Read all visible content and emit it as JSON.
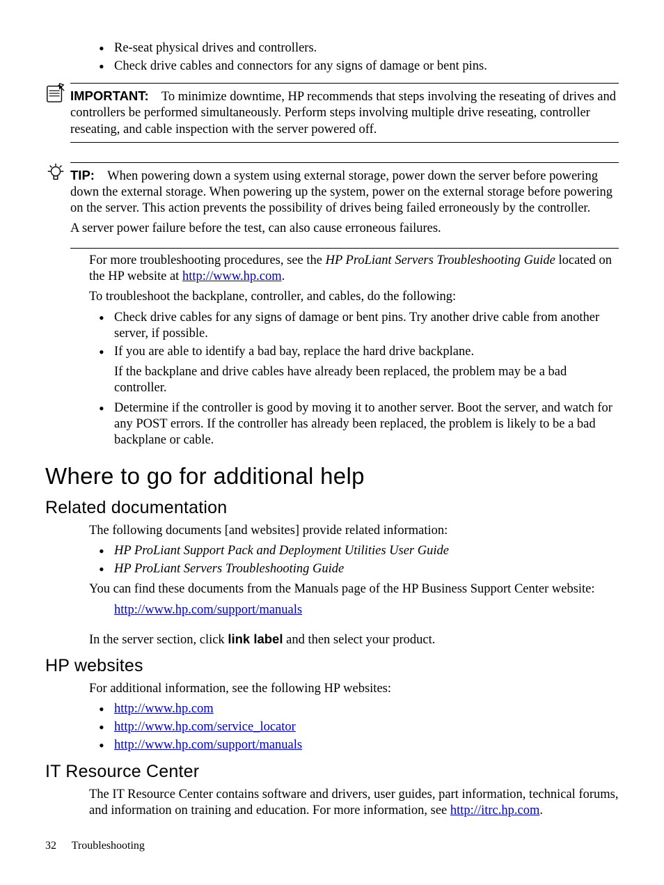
{
  "top_bullets": [
    "Re-seat physical drives and controllers.",
    "Check drive cables and connectors for any signs of damage or bent pins."
  ],
  "important": {
    "label": "IMPORTANT:",
    "text": "To minimize downtime, HP recommends that steps involving the reseating of drives and controllers be performed simultaneously. Perform steps involving multiple drive reseating, controller reseating, and cable inspection with the server powered off."
  },
  "tip": {
    "label": "TIP:",
    "p1": "When powering down a system using external storage, power down the server before powering down the external storage. When powering up the system, power on the external storage before powering on the server. This action prevents the possibility of drives being failed erroneously by the controller.",
    "p2": "A server power failure before the test, can also cause erroneous failures."
  },
  "after_tip": {
    "p1_pre": "For more troubleshooting procedures, see the ",
    "p1_em": "HP ProLiant Servers Troubleshooting Guide",
    "p1_mid": " located on the HP website at ",
    "p1_link": "http://www.hp.com",
    "p1_post": ".",
    "p2": "To troubleshoot the backplane, controller, and cables, do the following:"
  },
  "troubleshoot_bullets": {
    "b1": "Check drive cables for any signs of damage or bent pins. Try another drive cable from another server, if possible.",
    "b2": "If you are able to identify a bad bay, replace the hard drive backplane.",
    "b2b": "If the backplane and drive cables have already been replaced, the problem may be a bad controller.",
    "b3": "Determine if the controller is good by moving it to another server. Boot the server, and watch for any POST errors. If the controller has already been replaced, the problem is likely to be a bad backplane or cable."
  },
  "h1": "Where to go for additional help",
  "related": {
    "heading": "Related documentation",
    "intro": "The following documents [and websites] provide related information:",
    "d1": "HP ProLiant Support Pack and Deployment Utilities User Guide",
    "d2": "HP ProLiant Servers Troubleshooting Guide",
    "p2": "You can find these documents from the Manuals page of the HP Business Support Center website:",
    "link": "http://www.hp.com/support/manuals",
    "p3_pre": "In the server section, click ",
    "p3_bold": "link label",
    "p3_post": " and then select your product."
  },
  "hpweb": {
    "heading": "HP websites",
    "intro": "For additional information, see the following HP websites:",
    "l1": "http://www.hp.com",
    "l2": "http://www.hp.com/service_locator",
    "l3": "http://www.hp.com/support/manuals"
  },
  "itrc": {
    "heading": "IT Resource Center",
    "text_pre": "The IT Resource Center contains software and drivers, user guides, part information, technical forums, and information on training and education. For more information, see ",
    "link": "http://itrc.hp.com",
    "text_post": "."
  },
  "footer": {
    "page": "32",
    "section": "Troubleshooting"
  }
}
